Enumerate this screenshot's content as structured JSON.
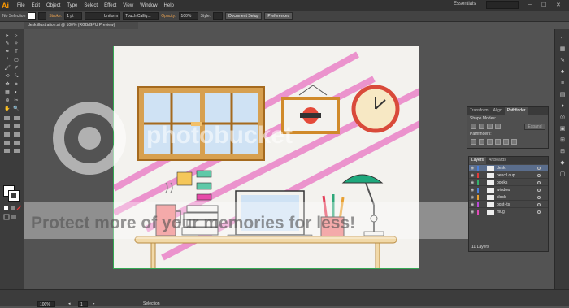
{
  "app": {
    "logo": "Ai"
  },
  "menubar": {
    "items": [
      "File",
      "Edit",
      "Object",
      "Type",
      "Select",
      "Effect",
      "View",
      "Window",
      "Help"
    ],
    "workspace": "Essentials",
    "window_controls": [
      "–",
      "☐",
      "✕"
    ]
  },
  "controlbar": {
    "selection": "No Selection",
    "stroke_label": "Stroke:",
    "stroke_weight": "1 pt",
    "profile": "Uniform",
    "brush": "Touch Callig...",
    "opacity_label": "Opacity:",
    "opacity_value": "100%",
    "style_label": "Style:",
    "document_setup": "Document Setup",
    "preferences": "Preferences"
  },
  "document": {
    "tab_title": "desk illustration.ai @ 100% (RGB/GPU Preview)"
  },
  "tools": [
    "▸",
    "▹",
    "✎",
    "✧",
    "✒",
    "T",
    "/",
    "▢",
    "🖌",
    "✐",
    "⟲",
    "⤡",
    "✥",
    "⌗",
    "▦",
    "◐",
    "⊕",
    "✂",
    "✋",
    "🔍"
  ],
  "colors": {
    "fill": "#ffffff",
    "stroke": "#ffffff",
    "artboard_border": "#34a853",
    "layer_selected": "#5a6d8c"
  },
  "pathfinder": {
    "tabs": [
      "Transform",
      "Align",
      "Pathfinder"
    ],
    "active_tab": "Pathfinder",
    "shape_modes": "Shape Modes:",
    "pathfinders": "Pathfinders:",
    "expand": "Expand"
  },
  "layers": {
    "tabs": [
      "Layers",
      "Artboards"
    ],
    "items": [
      {
        "name": "desk",
        "color": "#4a7fd9",
        "selected": true
      },
      {
        "name": "pencil cup",
        "color": "#e23b3b",
        "selected": false
      },
      {
        "name": "books",
        "color": "#34b36b",
        "selected": false
      },
      {
        "name": "window",
        "color": "#4a7fd9",
        "selected": false
      },
      {
        "name": "clock",
        "color": "#e8a030",
        "selected": false
      },
      {
        "name": "post-its",
        "color": "#b94ad9",
        "selected": false
      },
      {
        "name": "mug",
        "color": "#e24ab9",
        "selected": false
      }
    ],
    "count": "11 Layers"
  },
  "status": {
    "zoom": "100%",
    "artboard": "1",
    "tool": "Selection"
  },
  "watermark": {
    "brand": "photobucket",
    "slogan": "Protect more of your memories for less!"
  }
}
